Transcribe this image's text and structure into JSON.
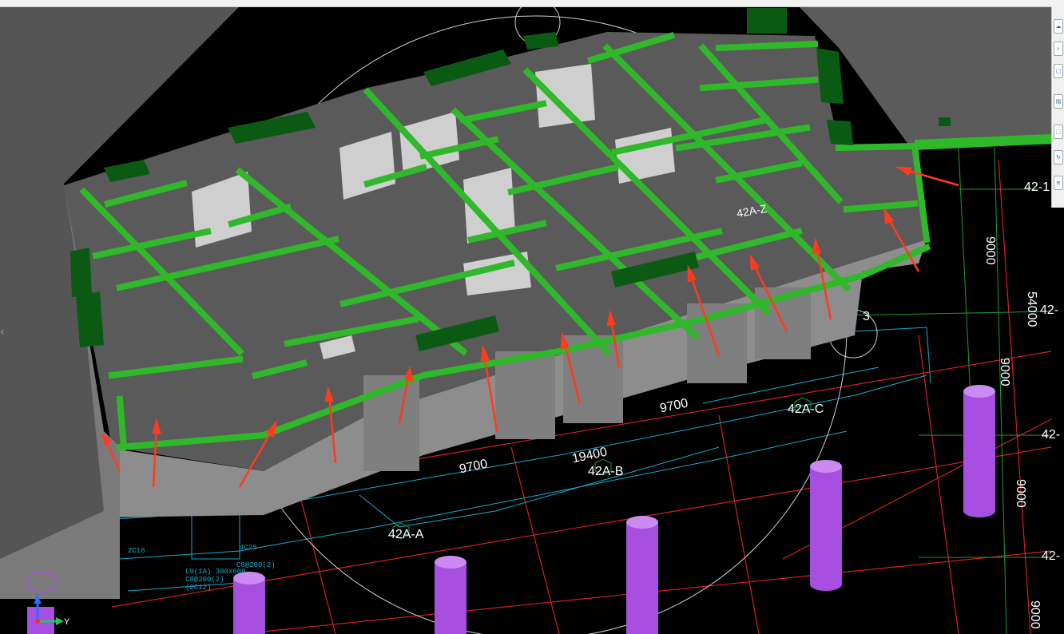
{
  "axes": {
    "a": "42A-A",
    "b": "42A-B",
    "c": "42A-C",
    "r1": "42-1",
    "r2": "42-",
    "r3": "42-",
    "r4": "42-",
    "node": "3"
  },
  "dimensions": {
    "d9700a": "9700",
    "d19400": "19400",
    "d9700b": "9700",
    "d54000": "54000",
    "v9000a": "9000",
    "v9000b": "9000",
    "v9000c": "9000",
    "v9000d": "9000"
  },
  "model_labels": {
    "wall_tag": "42A-Z"
  },
  "beam_annotations": {
    "l9": "L9(1A) 300x600",
    "l9b": "C8@200(2)",
    "l9c": "(2C12)",
    "c8": "C8@200(2)",
    "c16": "2C16",
    "c25": "4C25"
  },
  "axis_gizmo": {
    "z": "Z",
    "y": "Y"
  },
  "toolbar": {
    "icons": [
      "cloud-icon",
      "zoom-icon",
      "box-icon",
      "layer-icon",
      "select-icon",
      "refresh-icon",
      "list-icon"
    ]
  },
  "colors": {
    "slab": "#5a5a5a",
    "beam": "#2fb82a",
    "beam_dark": "#0b5a14",
    "wall": "#9a9a9a",
    "column": "#a64fe0",
    "grid_red": "#d42020",
    "grid_green": "#1e9a35",
    "plan_cyan": "#1aa9c9",
    "arrow": "#ff3b1f"
  }
}
